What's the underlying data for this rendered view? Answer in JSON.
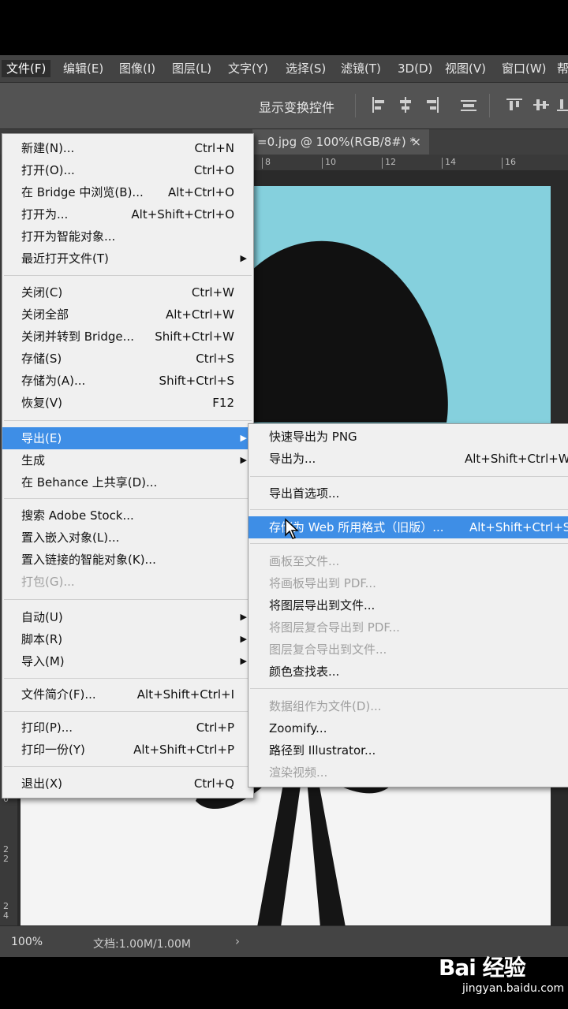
{
  "menubar": {
    "items": [
      "文件(F)",
      "编辑(E)",
      "图像(I)",
      "图层(L)",
      "文字(Y)",
      "选择(S)",
      "滤镜(T)",
      "3D(D)",
      "视图(V)",
      "窗口(W)",
      "帮"
    ]
  },
  "options_bar": {
    "show_transform_label": "显示变换控件"
  },
  "document_tab": {
    "title": "=0.jpg @ 100%(RGB/8#) *",
    "close": "×"
  },
  "ruler": {
    "top_ticks": [
      "8",
      "10",
      "12",
      "14",
      "16"
    ],
    "left_ticks": [
      "2 0",
      "2 2",
      "2 4"
    ]
  },
  "status": {
    "zoom": "100%",
    "doc_size": "文档:1.00M/1.00M",
    "arrow": "›"
  },
  "file_menu": {
    "items": [
      {
        "label": "新建(N)...",
        "shortcut": "Ctrl+N"
      },
      {
        "label": "打开(O)...",
        "shortcut": "Ctrl+O"
      },
      {
        "label": "在 Bridge 中浏览(B)...",
        "shortcut": "Alt+Ctrl+O"
      },
      {
        "label": "打开为...",
        "shortcut": "Alt+Shift+Ctrl+O"
      },
      {
        "label": "打开为智能对象...",
        "shortcut": ""
      },
      {
        "label": "最近打开文件(T)",
        "shortcut": ""
      },
      {
        "label": "关闭(C)",
        "shortcut": "Ctrl+W"
      },
      {
        "label": "关闭全部",
        "shortcut": "Alt+Ctrl+W"
      },
      {
        "label": "关闭并转到 Bridge...",
        "shortcut": "Shift+Ctrl+W"
      },
      {
        "label": "存储(S)",
        "shortcut": "Ctrl+S"
      },
      {
        "label": "存储为(A)...",
        "shortcut": "Shift+Ctrl+S"
      },
      {
        "label": "恢复(V)",
        "shortcut": "F12"
      },
      {
        "label": "导出(E)",
        "shortcut": ""
      },
      {
        "label": "生成",
        "shortcut": ""
      },
      {
        "label": "在 Behance 上共享(D)...",
        "shortcut": ""
      },
      {
        "label": "搜索 Adobe Stock...",
        "shortcut": ""
      },
      {
        "label": "置入嵌入对象(L)...",
        "shortcut": ""
      },
      {
        "label": "置入链接的智能对象(K)...",
        "shortcut": ""
      },
      {
        "label": "打包(G)...",
        "shortcut": ""
      },
      {
        "label": "自动(U)",
        "shortcut": ""
      },
      {
        "label": "脚本(R)",
        "shortcut": ""
      },
      {
        "label": "导入(M)",
        "shortcut": ""
      },
      {
        "label": "文件简介(F)...",
        "shortcut": "Alt+Shift+Ctrl+I"
      },
      {
        "label": "打印(P)...",
        "shortcut": "Ctrl+P"
      },
      {
        "label": "打印一份(Y)",
        "shortcut": "Alt+Shift+Ctrl+P"
      },
      {
        "label": "退出(X)",
        "shortcut": "Ctrl+Q"
      }
    ]
  },
  "export_menu": {
    "items": [
      {
        "label": "快速导出为 PNG",
        "shortcut": ""
      },
      {
        "label": "导出为...",
        "shortcut": "Alt+Shift+Ctrl+W"
      },
      {
        "label": "导出首选项...",
        "shortcut": ""
      },
      {
        "label": "存储为 Web 所用格式（旧版）...",
        "shortcut": "Alt+Shift+Ctrl+S"
      },
      {
        "label": "画板至文件...",
        "shortcut": ""
      },
      {
        "label": "将画板导出到 PDF...",
        "shortcut": ""
      },
      {
        "label": "将图层导出到文件...",
        "shortcut": ""
      },
      {
        "label": "将图层复合导出到 PDF...",
        "shortcut": ""
      },
      {
        "label": "图层复合导出到文件...",
        "shortcut": ""
      },
      {
        "label": "颜色查找表...",
        "shortcut": ""
      },
      {
        "label": "数据组作为文件(D)...",
        "shortcut": ""
      },
      {
        "label": "Zoomify...",
        "shortcut": ""
      },
      {
        "label": "路径到 Illustrator...",
        "shortcut": ""
      },
      {
        "label": "渲染视频...",
        "shortcut": ""
      }
    ]
  },
  "watermark": {
    "logo": "Bai 经验",
    "url": "jingyan.baidu.com"
  },
  "colors": {
    "highlight": "#3e8ee6",
    "photo_background": "#85d0dd",
    "menu_background": "#f0f0f0"
  }
}
